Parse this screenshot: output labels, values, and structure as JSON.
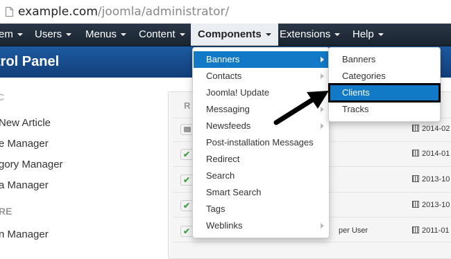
{
  "browser": {
    "url_host": "example.com",
    "url_path": "/joomla/administrator/"
  },
  "nav": {
    "items": [
      {
        "label": "em"
      },
      {
        "label": "Users"
      },
      {
        "label": "Menus"
      },
      {
        "label": "Content"
      },
      {
        "label": "Components"
      },
      {
        "label": "Extensions"
      },
      {
        "label": "Help"
      }
    ]
  },
  "header": {
    "title": "trol Panel"
  },
  "sidebar": {
    "top_mark": "C",
    "items": [
      "New Article",
      "e Manager",
      "gory Manager",
      "a Manager"
    ],
    "section_heading": "RE",
    "section_items": [
      "n Manager"
    ]
  },
  "panel": {
    "column_header": "R",
    "dates": [
      "2014-02",
      "2014-01",
      "2013-10",
      "2013-10",
      "2011-01"
    ],
    "author_snippet": "per User"
  },
  "components_menu": {
    "items": [
      "Banners",
      "Contacts",
      "Joomla! Update",
      "Messaging",
      "Newsfeeds",
      "Post-installation Messages",
      "Redirect",
      "Search",
      "Smart Search",
      "Tags",
      "Weblinks"
    ]
  },
  "banners_submenu": {
    "items": [
      "Banners",
      "Categories",
      "Clients",
      "Tracks"
    ]
  },
  "colors": {
    "accent": "#1179c6",
    "navbar": "#1a2431",
    "header": "#1d5aa0"
  }
}
